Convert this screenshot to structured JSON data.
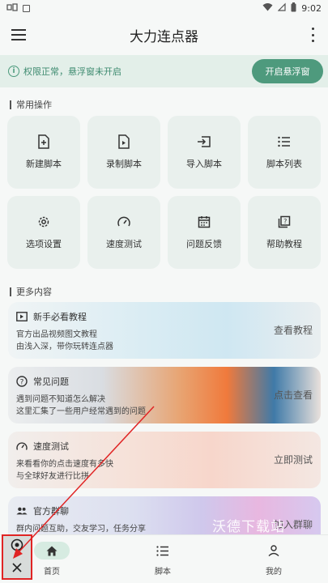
{
  "status": {
    "time": "9:02"
  },
  "appbar": {
    "title": "大力连点器"
  },
  "notice": {
    "text": "权限正常，悬浮窗未开启",
    "button": "开启悬浮窗"
  },
  "sections": {
    "common": "常用操作",
    "more": "更多内容"
  },
  "tiles": [
    {
      "label": "新建脚本",
      "icon": "new-file-icon"
    },
    {
      "label": "录制脚本",
      "icon": "record-file-icon"
    },
    {
      "label": "导入脚本",
      "icon": "import-icon"
    },
    {
      "label": "脚本列表",
      "icon": "list-icon"
    },
    {
      "label": "选项设置",
      "icon": "gear-icon"
    },
    {
      "label": "速度测试",
      "icon": "speedometer-icon"
    },
    {
      "label": "问题反馈",
      "icon": "calendar-icon"
    },
    {
      "label": "帮助教程",
      "icon": "help-icon"
    }
  ],
  "cards": [
    {
      "title": "新手必看教程",
      "desc1": "官方出品视频图文教程",
      "desc2": "由浅入深，带你玩转连点器",
      "action": "查看教程",
      "icon": "video-icon"
    },
    {
      "title": "常见问题",
      "desc1": "遇到问题不知道怎么解决",
      "desc2": "这里汇集了一些用户经常遇到的问题",
      "action": "点击查看",
      "icon": "question-icon"
    },
    {
      "title": "速度测试",
      "desc1": "来看看你的点击速度有多快",
      "desc2": "与全球好友进行比拼",
      "action": "立即测试",
      "icon": "speedometer-icon"
    },
    {
      "title": "官方群聊",
      "desc1": "群内问题互助，交友学习，任务分享",
      "desc2": "",
      "action": "加入群聊",
      "icon": "group-icon"
    }
  ],
  "nav": {
    "home": "首页",
    "scripts": "脚本",
    "mine": "我的"
  },
  "watermark": "沃德下载站",
  "colors": {
    "accent": "#4e9a7d",
    "notice_bg": "#e3efe9",
    "tile_bg": "#e9f0ed",
    "highlight": "#e02424"
  }
}
